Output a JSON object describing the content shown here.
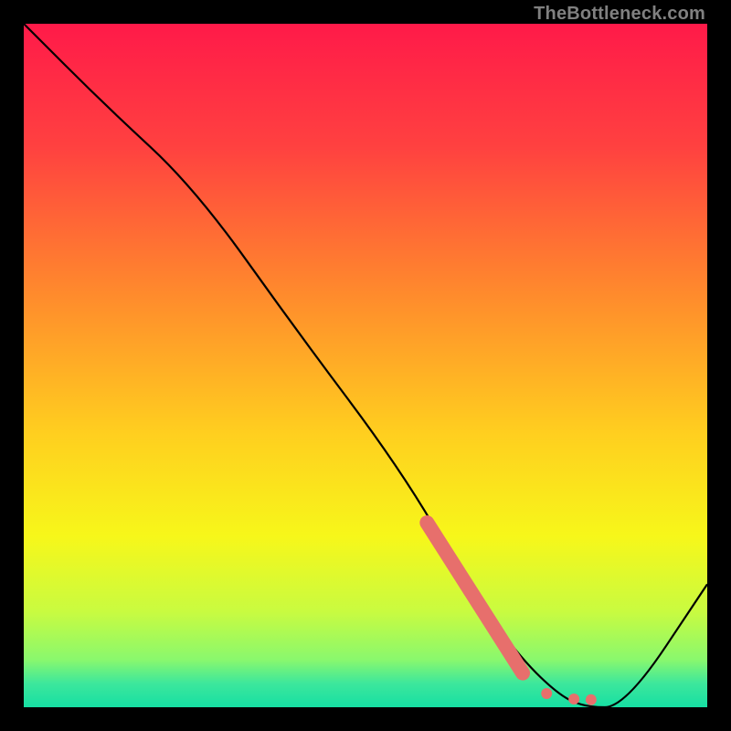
{
  "watermark": "TheBottleneck.com",
  "chart_data": {
    "type": "line",
    "title": "",
    "xlabel": "",
    "ylabel": "",
    "xlim": [
      0,
      100
    ],
    "ylim": [
      0,
      100
    ],
    "grid": false,
    "legend": false,
    "series": [
      {
        "name": "bottleneck-curve",
        "type": "line",
        "x": [
          0,
          12,
          25,
          40,
          55,
          65,
          72,
          78,
          82,
          88,
          100
        ],
        "y": [
          100,
          88,
          76,
          55,
          35,
          18,
          8,
          2,
          0,
          0,
          18
        ],
        "stroke": "#000000",
        "stroke_width": 2
      },
      {
        "name": "highlight-segment",
        "type": "thick-line",
        "x_range": [
          59,
          73
        ],
        "y_range": [
          27,
          5
        ],
        "color": "#e76f6c",
        "width": 12
      },
      {
        "name": "highlight-dots",
        "type": "scatter",
        "points": [
          {
            "x": 76.5,
            "y": 2.0
          },
          {
            "x": 80.5,
            "y": 1.2
          },
          {
            "x": 83.0,
            "y": 1.1
          }
        ],
        "color": "#e76f6c",
        "radius": 6
      }
    ],
    "background_gradient": {
      "type": "vertical",
      "stops": [
        {
          "pos": 0.0,
          "color": "#ff1a49"
        },
        {
          "pos": 0.18,
          "color": "#ff4140"
        },
        {
          "pos": 0.4,
          "color": "#ff8c2c"
        },
        {
          "pos": 0.6,
          "color": "#ffcf1f"
        },
        {
          "pos": 0.75,
          "color": "#f7f71a"
        },
        {
          "pos": 0.86,
          "color": "#c9fb40"
        },
        {
          "pos": 0.93,
          "color": "#8af86d"
        },
        {
          "pos": 0.965,
          "color": "#3de79c"
        },
        {
          "pos": 1.0,
          "color": "#16dfa3"
        }
      ]
    }
  }
}
